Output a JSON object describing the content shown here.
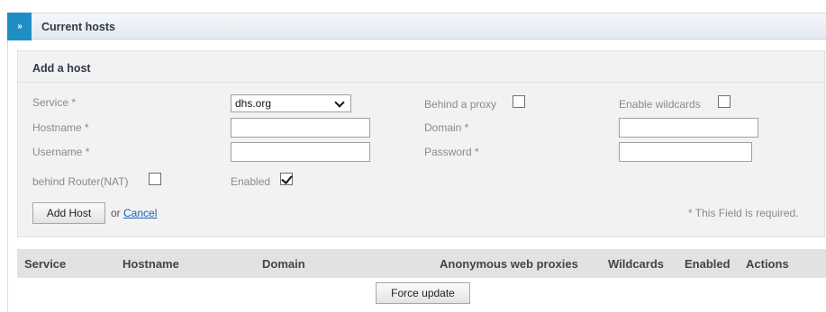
{
  "header": {
    "title": "Current hosts",
    "toggle_glyph": "»"
  },
  "form": {
    "title": "Add a host",
    "service_label": "Service *",
    "service_value": "dhs.org",
    "behind_proxy_label": "Behind a proxy",
    "behind_proxy_checked": false,
    "enable_wildcards_label": "Enable wildcards",
    "enable_wildcards_checked": false,
    "hostname_label": "Hostname *",
    "hostname_value": "",
    "domain_label": "Domain *",
    "domain_value": "",
    "username_label": "Username *",
    "username_value": "",
    "password_label": "Password *",
    "password_value": "",
    "behind_router_label": "behind Router(NAT)",
    "behind_router_checked": false,
    "enabled_label": "Enabled",
    "enabled_checked": true,
    "add_host_button": "Add Host",
    "or_text": "or",
    "cancel_link": "Cancel",
    "required_note": "* This Field is required."
  },
  "table": {
    "columns": [
      "Service",
      "Hostname",
      "Domain",
      "Anonymous web proxies",
      "Wildcards",
      "Enabled",
      "Actions"
    ]
  },
  "force_update_button": "Force update"
}
